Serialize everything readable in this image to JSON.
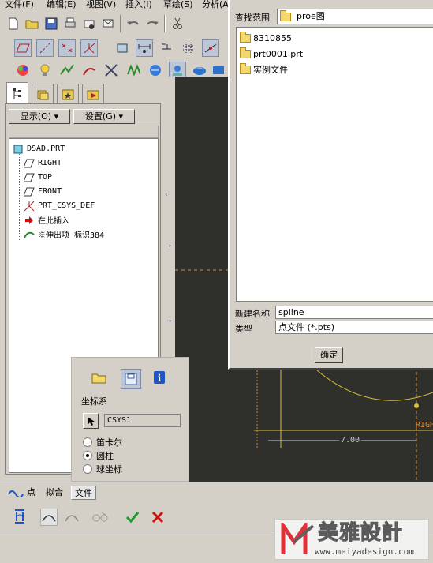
{
  "menu": {
    "items": [
      "文件(F)",
      "编辑(E)",
      "视图(V)",
      "插入(I)",
      "草绘(S)",
      "分析(A"
    ]
  },
  "model_tree": {
    "show_menu": "显示(O)",
    "settings_menu": "设置(G)",
    "items": [
      {
        "label": "DSAD.PRT",
        "icon": "part-icon"
      },
      {
        "label": "RIGHT",
        "icon": "datum-plane-icon"
      },
      {
        "label": "TOP",
        "icon": "datum-plane-icon"
      },
      {
        "label": "FRONT",
        "icon": "datum-plane-icon"
      },
      {
        "label": "PRT_CSYS_DEF",
        "icon": "csys-icon"
      },
      {
        "label": "在此插入",
        "icon": "insert-arrow-icon"
      },
      {
        "label": "※伸出项 标识384",
        "icon": "protrusion-icon"
      }
    ]
  },
  "file_dialog": {
    "look_in_label": "查找范围",
    "look_in_value": "proe图",
    "files": [
      "8310855",
      "prt0001.prt",
      "实例文件"
    ],
    "new_name_label": "新建名称",
    "new_name_value": "spline",
    "type_label": "类型",
    "type_value": "点文件 (*.pts)",
    "ok_label": "确定"
  },
  "curve_panel": {
    "csys_label": "坐标系",
    "csys_value": "CSYS1",
    "options": [
      "笛卡尔",
      "圆柱",
      "球坐标"
    ],
    "selected_option": 1
  },
  "graphics": {
    "dimension_value": "7.00",
    "datum_label": "RIGH"
  },
  "dashboard": {
    "tabs": [
      "点",
      "拟合",
      "文件"
    ],
    "active_tab": 2
  },
  "watermark": {
    "brand": "美雅設計",
    "url": "www.meiyadesign.com"
  },
  "colors": {
    "graphics_bg": "#2f2f2b",
    "sketch_yellow": "#d8c23a",
    "dim_orange": "#d98c3a",
    "confirm_green": "#1a9a2a",
    "cancel_red": "#cc1010"
  }
}
